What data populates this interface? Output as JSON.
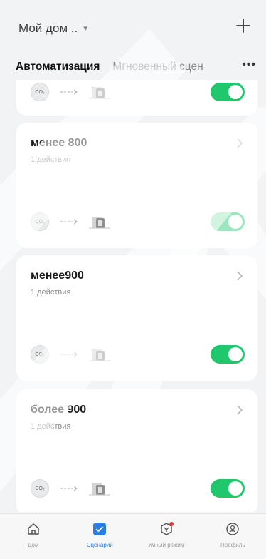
{
  "header": {
    "home_name": "Мой дом ..",
    "caret_icon": "caret-down-icon",
    "add_icon": "plus-icon"
  },
  "tabs": {
    "items": [
      {
        "label": "Автоматизация",
        "active": true
      },
      {
        "label": "Мгновенный сцен",
        "active": false
      }
    ],
    "more_icon": "more-icon",
    "more_glyph": "•••"
  },
  "scenes": [
    {
      "title": "",
      "subtitle": "",
      "enabled": true,
      "partial": true
    },
    {
      "title": "менее 800",
      "subtitle": "1 действия",
      "enabled": true
    },
    {
      "title": "менее900",
      "subtitle": "1 действия",
      "enabled": true
    },
    {
      "title": "более 900",
      "subtitle": "1 действия",
      "enabled": true
    }
  ],
  "condition_icon_label": "CO₂",
  "bottom_nav": [
    {
      "label": "Дом",
      "icon": "home-icon",
      "active": false
    },
    {
      "label": "Сценарий",
      "icon": "scenario-icon",
      "active": true
    },
    {
      "label": "Умный режим",
      "icon": "smart-mode-icon",
      "active": false
    },
    {
      "label": "Профиль",
      "icon": "profile-icon",
      "active": false
    }
  ],
  "colors": {
    "toggle_on": "#1fc86d",
    "accent": "#2a7de1",
    "background": "#f2f3f5",
    "notification_dot": "#e53935"
  }
}
